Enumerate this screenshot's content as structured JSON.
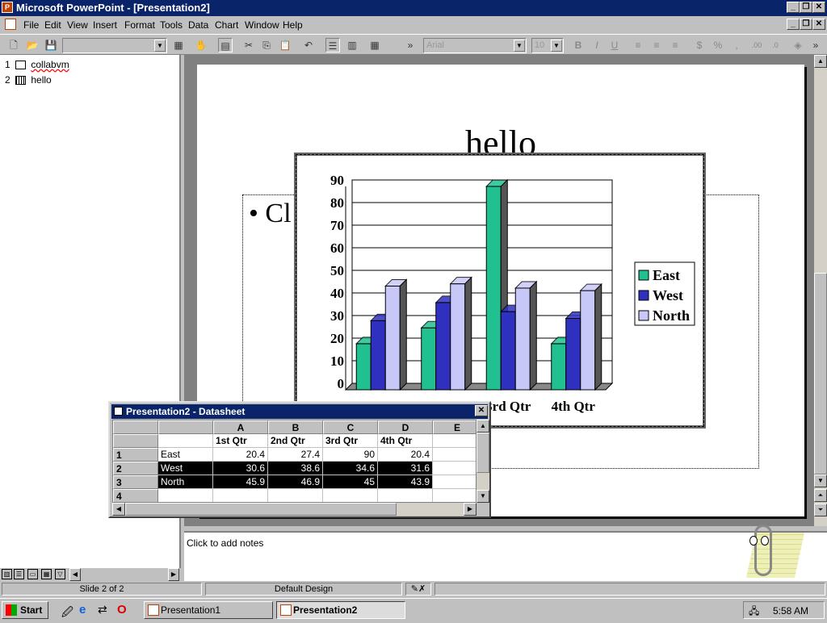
{
  "window": {
    "title": "Microsoft PowerPoint - [Presentation2]"
  },
  "menu": [
    "File",
    "Edit",
    "View",
    "Insert",
    "Format",
    "Tools",
    "Data",
    "Chart",
    "Window",
    "Help"
  ],
  "toolbar": {
    "font": "Arial",
    "size": "10"
  },
  "outline": {
    "items": [
      {
        "num": "1",
        "label": "collabvm"
      },
      {
        "num": "2",
        "label": "hello"
      }
    ]
  },
  "slide": {
    "title": "hello",
    "bullet_partial": "Cl"
  },
  "chart_data": {
    "type": "bar",
    "categories": [
      "1st Qtr",
      "2nd Qtr",
      "3rd Qtr",
      "4th Qtr"
    ],
    "series": [
      {
        "name": "East",
        "values": [
          20.4,
          27.4,
          90,
          20.4
        ],
        "color": "#20c090"
      },
      {
        "name": "West",
        "values": [
          30.6,
          38.6,
          34.6,
          31.6
        ],
        "color": "#3030c0"
      },
      {
        "name": "North",
        "values": [
          45.9,
          46.9,
          45,
          43.9
        ],
        "color": "#c8c8f8"
      }
    ],
    "ylim": [
      0,
      90
    ],
    "yticks": [
      "0",
      "10",
      "20",
      "30",
      "40",
      "50",
      "60",
      "70",
      "80",
      "90"
    ],
    "legend": "right"
  },
  "datasheet": {
    "title": "Presentation2 - Datasheet",
    "col_headers": [
      "A",
      "B",
      "C",
      "D",
      "E"
    ],
    "header_row": [
      "1st Qtr",
      "2nd Qtr",
      "3rd Qtr",
      "4th Qtr"
    ],
    "rows": [
      {
        "num": "1",
        "label": "East",
        "values": [
          "20.4",
          "27.4",
          "90",
          "20.4"
        ]
      },
      {
        "num": "2",
        "label": "West",
        "values": [
          "30.6",
          "38.6",
          "34.6",
          "31.6"
        ]
      },
      {
        "num": "3",
        "label": "North",
        "values": [
          "45.9",
          "46.9",
          "45",
          "43.9"
        ]
      },
      {
        "num": "4",
        "label": "",
        "values": [
          "",
          "",
          "",
          ""
        ]
      }
    ]
  },
  "notes": {
    "placeholder": "Click to add notes"
  },
  "status": {
    "slide": "Slide 2 of 2",
    "design": "Default Design"
  },
  "taskbar": {
    "start": "Start",
    "tasks": [
      "Presentation1",
      "Presentation2"
    ],
    "clock": "5:58 AM"
  }
}
